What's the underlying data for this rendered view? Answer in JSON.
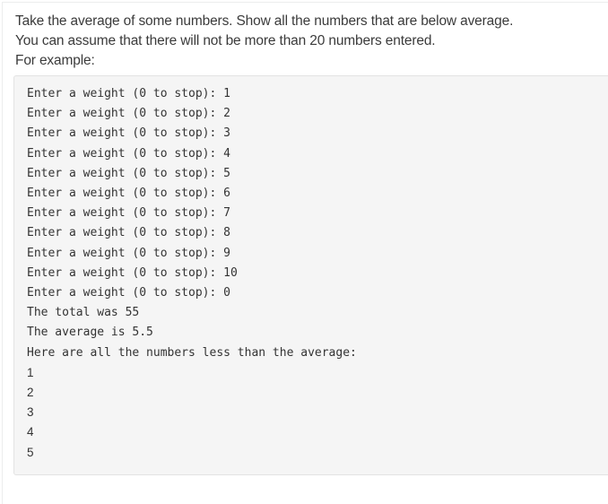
{
  "question": {
    "lines": [
      "Take the average of some numbers. Show all the numbers that are below average.",
      "You can assume that there will not be more than 20 numbers entered.",
      "For example:"
    ]
  },
  "example_output": {
    "prompt_lines": [
      "Enter a weight (0 to stop): 1",
      "Enter a weight (0 to stop): 2",
      "Enter a weight (0 to stop): 3",
      "Enter a weight (0 to stop): 4",
      "Enter a weight (0 to stop): 5",
      "Enter a weight (0 to stop): 6",
      "Enter a weight (0 to stop): 7",
      "Enter a weight (0 to stop): 8",
      "Enter a weight (0 to stop): 9",
      "Enter a weight (0 to stop): 10",
      "Enter a weight (0 to stop): 0",
      "The total was 55",
      "The average is 5.5",
      "Here are all the numbers less than the average:"
    ],
    "below_average_numbers": [
      "1",
      "2",
      "3",
      "4",
      "5"
    ]
  },
  "colors": {
    "page_background": "#ffffff",
    "example_background": "#f5f5f5",
    "example_border": "#e3e3e3",
    "text": "#333333",
    "question_text": "#3b3b3b"
  }
}
